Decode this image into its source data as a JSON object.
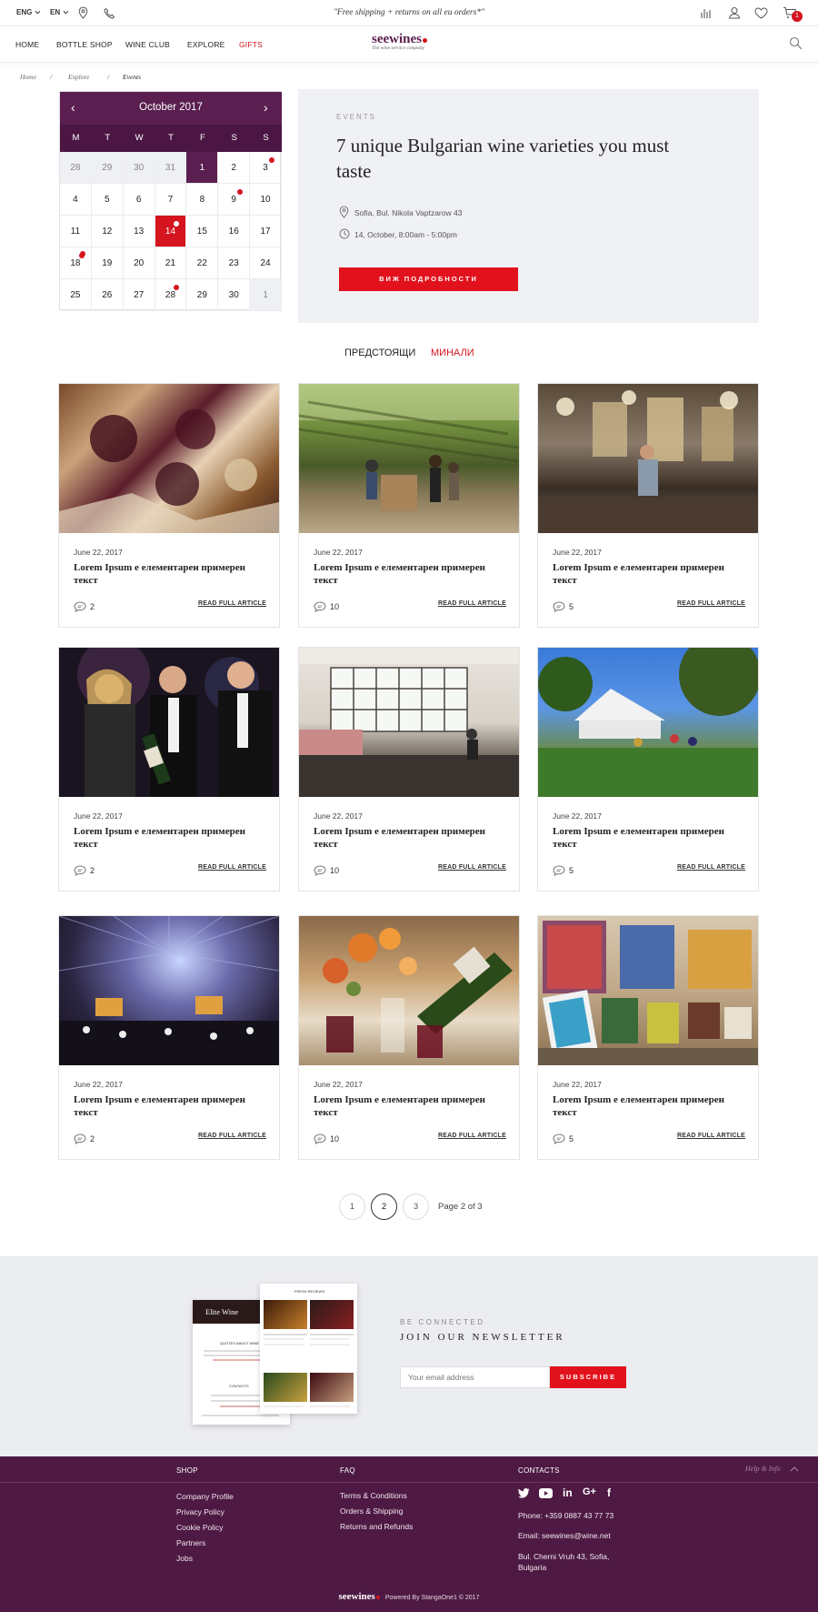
{
  "topbar": {
    "lang1": "ENG",
    "lang2": "EN",
    "promo": "\"Free shipping + returns on all eu orders*\"",
    "cart_count": "1"
  },
  "nav": {
    "items": [
      "HOME",
      "BOTTLE SHOP",
      "WINE CLUB",
      "EXPLORE",
      "GIFTS"
    ],
    "logo": "seewines",
    "logo_tagline": "The wine service company"
  },
  "breadcrumbs": [
    "Home",
    "/",
    "Explore",
    "/",
    "Events"
  ],
  "calendar": {
    "month": "October 2017",
    "weekdays": [
      "M",
      "T",
      "W",
      "T",
      "F",
      "S",
      "S"
    ],
    "days": [
      "28",
      "29",
      "30",
      "31",
      "1",
      "2",
      "3",
      "4",
      "5",
      "6",
      "7",
      "8",
      "9",
      "10",
      "11",
      "12",
      "13",
      "14",
      "15",
      "16",
      "17",
      "18",
      "19",
      "20",
      "21",
      "22",
      "23",
      "24",
      "25",
      "26",
      "27",
      "28",
      "29",
      "30",
      "1"
    ]
  },
  "event": {
    "label": "EVENTS",
    "title": "7 unique Bulgarian wine varieties you must taste",
    "address": "Sofia, Bul. Nikola Vaptzarow 43",
    "time": "14, October, 8:00am - 5:00pm",
    "button": "ВИЖ ПОДРОБНОСТИ"
  },
  "tabs": {
    "upcoming": "ПРЕДСТОЯЩИ",
    "past": "МИНАЛИ"
  },
  "cards": [
    {
      "date": "June 22, 2017",
      "title": "Lorem Ipsum е елементарен примерен текст",
      "comments": "2",
      "more": "READ FULL ARTICLE"
    },
    {
      "date": "June 22, 2017",
      "title": "Lorem Ipsum е елементарен примерен текст",
      "comments": "10",
      "more": "READ FULL ARTICLE"
    },
    {
      "date": "June 22, 2017",
      "title": "Lorem Ipsum е елементарен примерен текст",
      "comments": "5",
      "more": "READ FULL ARTICLE"
    },
    {
      "date": "June 22, 2017",
      "title": "Lorem Ipsum е елементарен примерен текст",
      "comments": "2",
      "more": "READ FULL ARTICLE"
    },
    {
      "date": "June 22, 2017",
      "title": "Lorem Ipsum е елементарен примерен текст",
      "comments": "10",
      "more": "READ FULL ARTICLE"
    },
    {
      "date": "June 22, 2017",
      "title": "Lorem Ipsum е елементарен примерен текст",
      "comments": "5",
      "more": "READ FULL ARTICLE"
    },
    {
      "date": "June 22, 2017",
      "title": "Lorem Ipsum е елементарен примерен текст",
      "comments": "2",
      "more": "READ FULL ARTICLE"
    },
    {
      "date": "June 22, 2017",
      "title": "Lorem Ipsum е елементарен примерен текст",
      "comments": "10",
      "more": "READ FULL ARTICLE"
    },
    {
      "date": "June 22, 2017",
      "title": "Lorem Ipsum е елементарен примерен текст",
      "comments": "5",
      "more": "READ FULL ARTICLE"
    }
  ],
  "pagination": {
    "pages": [
      "1",
      "2",
      "3"
    ],
    "info": "Page 2 of 3"
  },
  "newsletter": {
    "kicker": "BE CONNECTED",
    "title": "JOIN OUR NEWSLETTER",
    "placeholder": "Your email address",
    "button": "SUBSCRIBE",
    "preview_title": "Elite Wine",
    "preview_heading": "FRESH REVIEWS",
    "preview_quote": "QUOTES ABOUT WINE",
    "preview_contacts": "CONTACTS"
  },
  "footer": {
    "shop_heading": "SHOP",
    "shop_links": [
      "Company Profile",
      "Privacy Policy",
      "Cookie Policy",
      "Partners",
      "Jobs"
    ],
    "faq_heading": "FAQ",
    "faq_links": [
      "Terms & Conditions",
      "Orders & Shipping",
      "Returns and Refunds"
    ],
    "contacts_heading": "CONTACTS",
    "phone": "Phone: +359 0887 43 77  73",
    "email": "Email: seewines@wine.net",
    "address": "Bul. Cherni Vruh 43, Sofia, Bulgaria",
    "help": "Help & Info",
    "logo": "seewines",
    "powered": "Powered By StangaOne1 © 2017"
  },
  "colors": {
    "brand_purple": "#5a1f50",
    "accent_red": "#e2121d",
    "footer_bg": "#4e1a44",
    "panel_bg": "#f0f1f5"
  }
}
